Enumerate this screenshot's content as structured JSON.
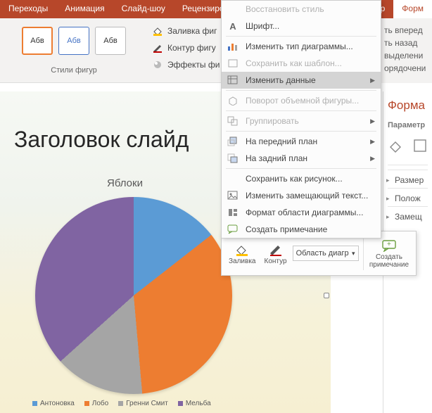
{
  "tabs": [
    "Переходы",
    "Анимация",
    "Слайд-шоу",
    "Рецензиро",
    "р",
    "Форм"
  ],
  "active_tab_index": 5,
  "ribbon": {
    "swatch_label": "Абв",
    "group_label": "Стили фигур",
    "fill": "Заливка фиг",
    "outline": "Контур фигу",
    "effects": "Эффекты фи"
  },
  "right_opts": [
    "ть вперед",
    "ть назад",
    "выделени",
    "орядочени"
  ],
  "slide": {
    "title": "Заголовок слайд",
    "chart_title": "Яблоки",
    "legend": [
      "Антоновка",
      "Лобо",
      "Гренни Смит",
      "Мельба"
    ]
  },
  "ctx_menu": [
    {
      "icon": "",
      "label": "Восстановить стиль",
      "disabled": true
    },
    {
      "icon": "A",
      "label": "Шрифт...",
      "sep_after": true
    },
    {
      "icon": "bar",
      "label": "Изменить тип диаграммы...",
      "disabled": false
    },
    {
      "icon": "tmpl",
      "label": "Сохранить как шаблон...",
      "disabled": true
    },
    {
      "icon": "edit",
      "label": "Изменить данные",
      "disabled": false,
      "highlight": true,
      "submenu": true,
      "sep_after": true
    },
    {
      "icon": "cube",
      "label": "Поворот объемной фигуры...",
      "disabled": true,
      "sep_after": true
    },
    {
      "icon": "group",
      "label": "Группировать",
      "disabled": true,
      "submenu": true,
      "sep_after": true
    },
    {
      "icon": "front",
      "label": "На передний план",
      "submenu": true
    },
    {
      "icon": "back",
      "label": "На задний план",
      "submenu": true,
      "sep_after": true
    },
    {
      "icon": "",
      "label": "Сохранить как рисунок..."
    },
    {
      "icon": "alt",
      "label": "Изменить замещающий текст..."
    },
    {
      "icon": "fmt",
      "label": "Формат области диаграммы..."
    },
    {
      "icon": "note",
      "label": "Создать примечание"
    }
  ],
  "mini_tb": {
    "fill": "Заливка",
    "outline": "Контур",
    "combo": "Область диагр",
    "comment_l1": "Создать",
    "comment_l2": "примечание"
  },
  "fmt_pane": {
    "title": "Форма",
    "subtitle": "Параметр",
    "sections": [
      "Размер",
      "Полож",
      "Замещ"
    ]
  },
  "chart_data": {
    "type": "pie",
    "title": "Яблоки",
    "series": [
      {
        "name": "Антоновка",
        "value": 14,
        "color": "#5b9bd5"
      },
      {
        "name": "Лобо",
        "value": 34,
        "color": "#ed7d31"
      },
      {
        "name": "Гренни Смит",
        "value": 15,
        "color": "#a5a5a5"
      },
      {
        "name": "Мельба",
        "value": 37,
        "color": "#8064a2"
      }
    ],
    "legend_position": "bottom"
  }
}
